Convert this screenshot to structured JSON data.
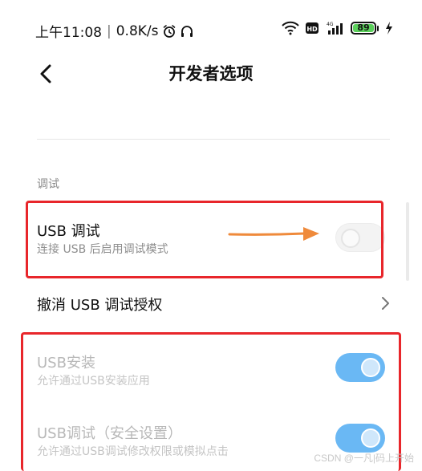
{
  "status_bar": {
    "time": "上午11:08",
    "net_speed": "0.8K/s",
    "battery_level": "89",
    "icons": [
      "alarm-icon",
      "headphone-icon",
      "wifi-icon",
      "hd-icon",
      "signal-4g-icon",
      "battery-icon",
      "charging-icon"
    ]
  },
  "header": {
    "title": "开发者选项"
  },
  "section": {
    "label": "调试"
  },
  "settings": {
    "usb_debug": {
      "title": "USB 调试",
      "subtitle": "连接 USB 后启用调试模式",
      "enabled": false
    },
    "revoke_usb_auth": {
      "title": "撤消 USB 调试授权"
    },
    "usb_install": {
      "title": "USB安装",
      "subtitle": "允许通过USB安装应用",
      "enabled": true
    },
    "usb_debug_security": {
      "title": "USB调试（安全设置）",
      "subtitle": "允许通过USB调试修改权限或模拟点击",
      "enabled": true
    }
  },
  "watermark": "CSDN @一凡|码上开始",
  "colors": {
    "highlight": "#e8262b",
    "arrow": "#ef8a3b",
    "toggle_on": "#6ab8f4",
    "battery": "#5bd05b"
  }
}
